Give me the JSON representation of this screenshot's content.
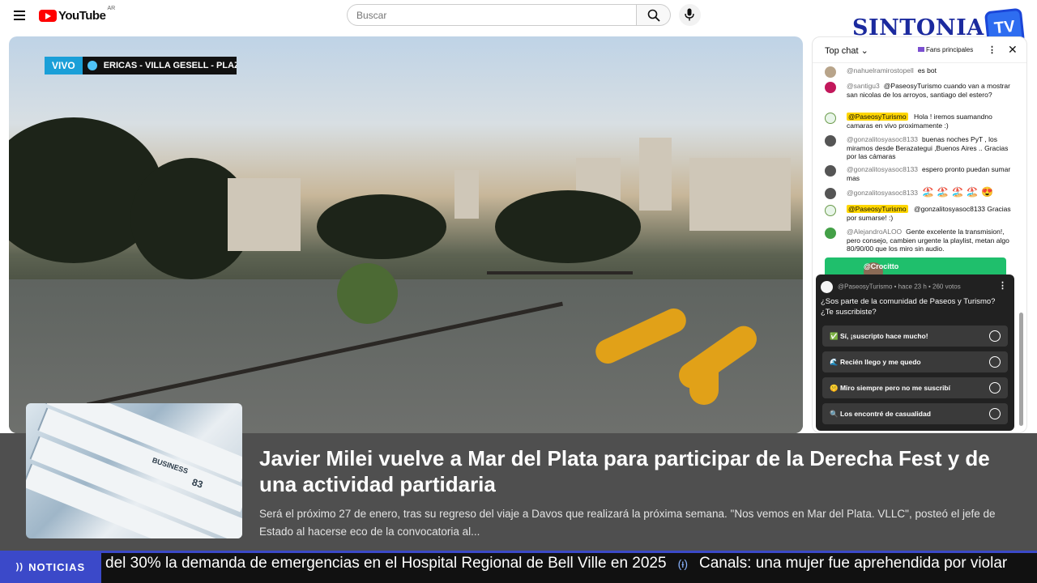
{
  "header": {
    "logo_text": "YouTube",
    "logo_country": "AR",
    "search_placeholder": "Buscar",
    "icons": [
      "menu-icon",
      "search-icon",
      "mic-icon"
    ]
  },
  "overlay_brand": {
    "name": "SINTONIA",
    "tv": "TV"
  },
  "video": {
    "live_badge": "VIVO",
    "location": "ERICAS - VILLA GESELL - PLAZ"
  },
  "chat": {
    "mode_label": "Top chat",
    "fans_label": "Fans principales",
    "messages": [
      {
        "user": "@nahuelramirostopell",
        "text": "es bot",
        "owner": false,
        "avatar_color": "#b8a48a"
      },
      {
        "user": "@santigu3",
        "text": "@PaseosyTurismo cuando van a mostrar san nicolas de los arroyos, santiago del estero?",
        "owner": false,
        "avatar_color": "#c2185b"
      },
      {
        "user": "@PaseosyTurismo",
        "text": "Hola ! iremos suamandno camaras en vivo proximamente :)",
        "owner": true,
        "avatar_color": "#e8f5e9"
      },
      {
        "user": "@gonzalitosyasoc8133",
        "text": "buenas noches PyT , los miramos desde Berazategui ,Buenos Aires .. Gracias por las cámaras",
        "owner": false,
        "avatar_color": "#555555"
      },
      {
        "user": "@gonzalitosyasoc8133",
        "text": "espero pronto puedan sumar mas",
        "owner": false,
        "avatar_color": "#555555"
      },
      {
        "user": "@gonzalitosyasoc8133",
        "text": "🏖️ 🏖️ 🏖️ 🏖️ 😍",
        "owner": false,
        "avatar_color": "#555555"
      },
      {
        "user": "@PaseosyTurismo",
        "text": "@gonzalitosyasoc8133 Gracias por sumarse! :)",
        "owner": true,
        "avatar_color": "#e8f5e9"
      },
      {
        "user": "@AlejandroALOO",
        "text": "Gente excelente la transmision!, pero consejo, cambien urgente la playlist, metan algo 80/90/00 que los miro sin audio.",
        "owner": false,
        "avatar_color": "#43a047"
      }
    ],
    "superchat_user": "@Crocitto"
  },
  "poll": {
    "meta": "@PaseosyTurismo • hace 23 h • 260 votos",
    "question": "¿Sos parte de la comunidad de Paseos y Turismo? ¿Te suscribiste?",
    "options": [
      "✅ Sí, ¡suscripto hace mucho!",
      "🌊 Recién llego y me quedo",
      "🤫 Miro siempre pero no me suscribí",
      "🔍 Los encontré de casualidad"
    ]
  },
  "news": {
    "thumb_text_1": "BUSINESS",
    "thumb_text_2": "83",
    "headline": "Javier Milei vuelve a Mar del Plata para participar de la Derecha Fest y de una actividad partidaria",
    "summary": "Será el próximo 27 de enero, tras su regreso del viaje a Davos que realizará la próxima semana. \"Nos vemos en Mar del Plata. VLLC\", posteó el jefe de Estado al hacerse eco de la convocatoria al..."
  },
  "ticker": {
    "label": "NOTICIAS",
    "item_1": "del 30% la demanda de emergencias en el Hospital Regional de Bell Ville en 2025",
    "item_2": "Canals: una mujer fue aprehendida por violar"
  },
  "colors": {
    "accent_blue": "#3b49c9",
    "live_blue": "#1a9fd8",
    "owner_highlight": "#ffd600",
    "superchat_green": "#1fbf6c"
  }
}
